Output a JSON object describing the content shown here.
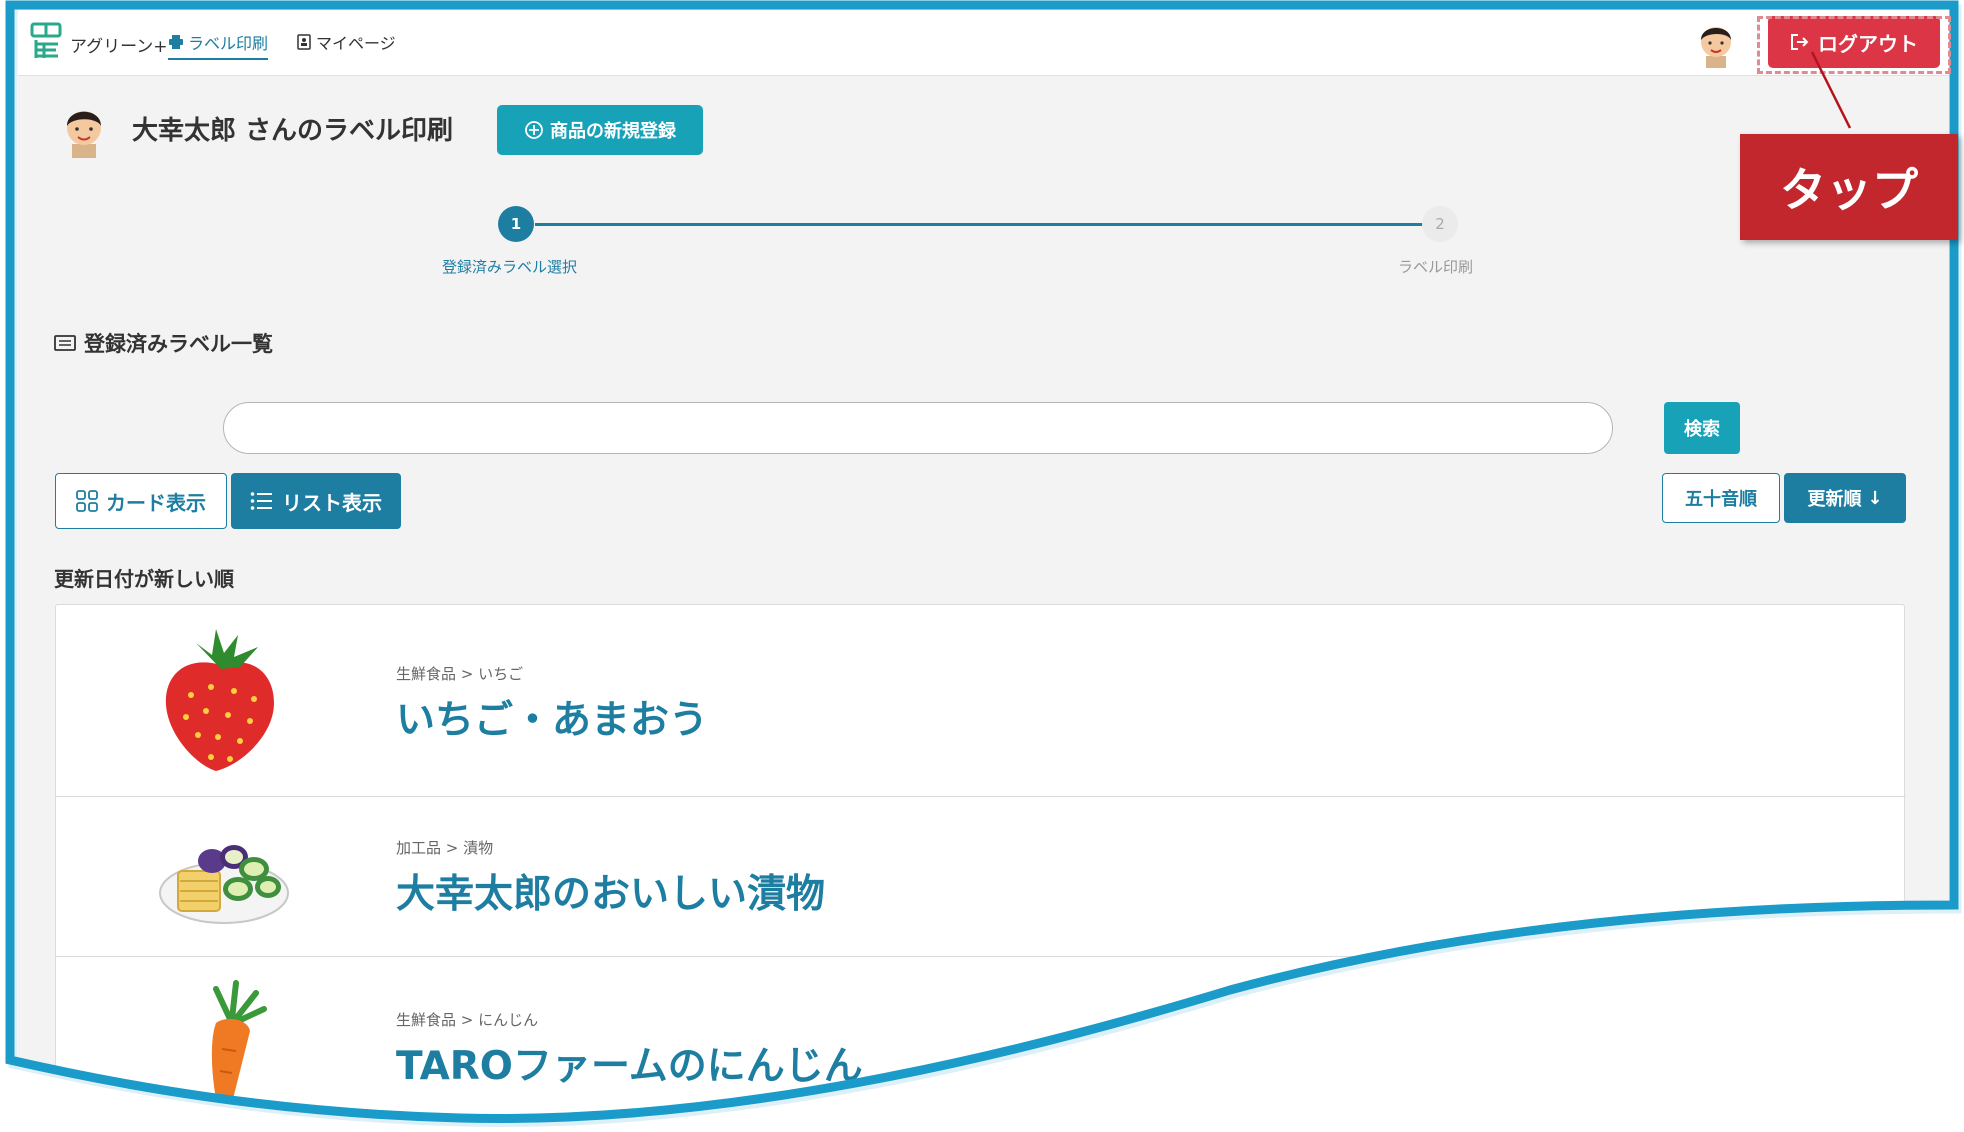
{
  "nav": {
    "brand": "アグリーン+",
    "items": [
      {
        "label": "ラベル印刷",
        "icon": "printer-icon",
        "active": true
      },
      {
        "label": "マイページ",
        "icon": "id-card-icon",
        "active": false
      }
    ],
    "logout_label": "ログアウト"
  },
  "header": {
    "title": "大幸太郎 さんのラベル印刷",
    "register_button": "商品の新規登録"
  },
  "stepper": {
    "steps": [
      {
        "number": "1",
        "label": "登録済みラベル選択",
        "active": true
      },
      {
        "number": "2",
        "label": "ラベル印刷",
        "active": false
      }
    ]
  },
  "section": {
    "title": "登録済みラベル一覧"
  },
  "search": {
    "value": "",
    "placeholder": "",
    "button": "検索"
  },
  "view_toggle": {
    "card": "カード表示",
    "list": "リスト表示",
    "selected": "list"
  },
  "sort": {
    "kana": "五十音順",
    "update": "更新順",
    "update_arrow": "↓",
    "caption": "更新日付が新しい順"
  },
  "products": [
    {
      "category": "生鮮食品 > いちご",
      "name": "いちご・あまおう",
      "image": "strawberry"
    },
    {
      "category": "加工品 > 漬物",
      "name": "大幸太郎のおいしい漬物",
      "image": "pickles"
    },
    {
      "category": "生鮮食品 > にんじん",
      "name": "TAROファームのにんじん",
      "image": "carrot"
    }
  ],
  "annotation": {
    "callout": "タップ"
  },
  "colors": {
    "accent": "#1d7ea1",
    "teal": "#17a2b8",
    "danger": "#dc3545",
    "callout": "#c1272d",
    "frame": "#1a9bc9"
  }
}
